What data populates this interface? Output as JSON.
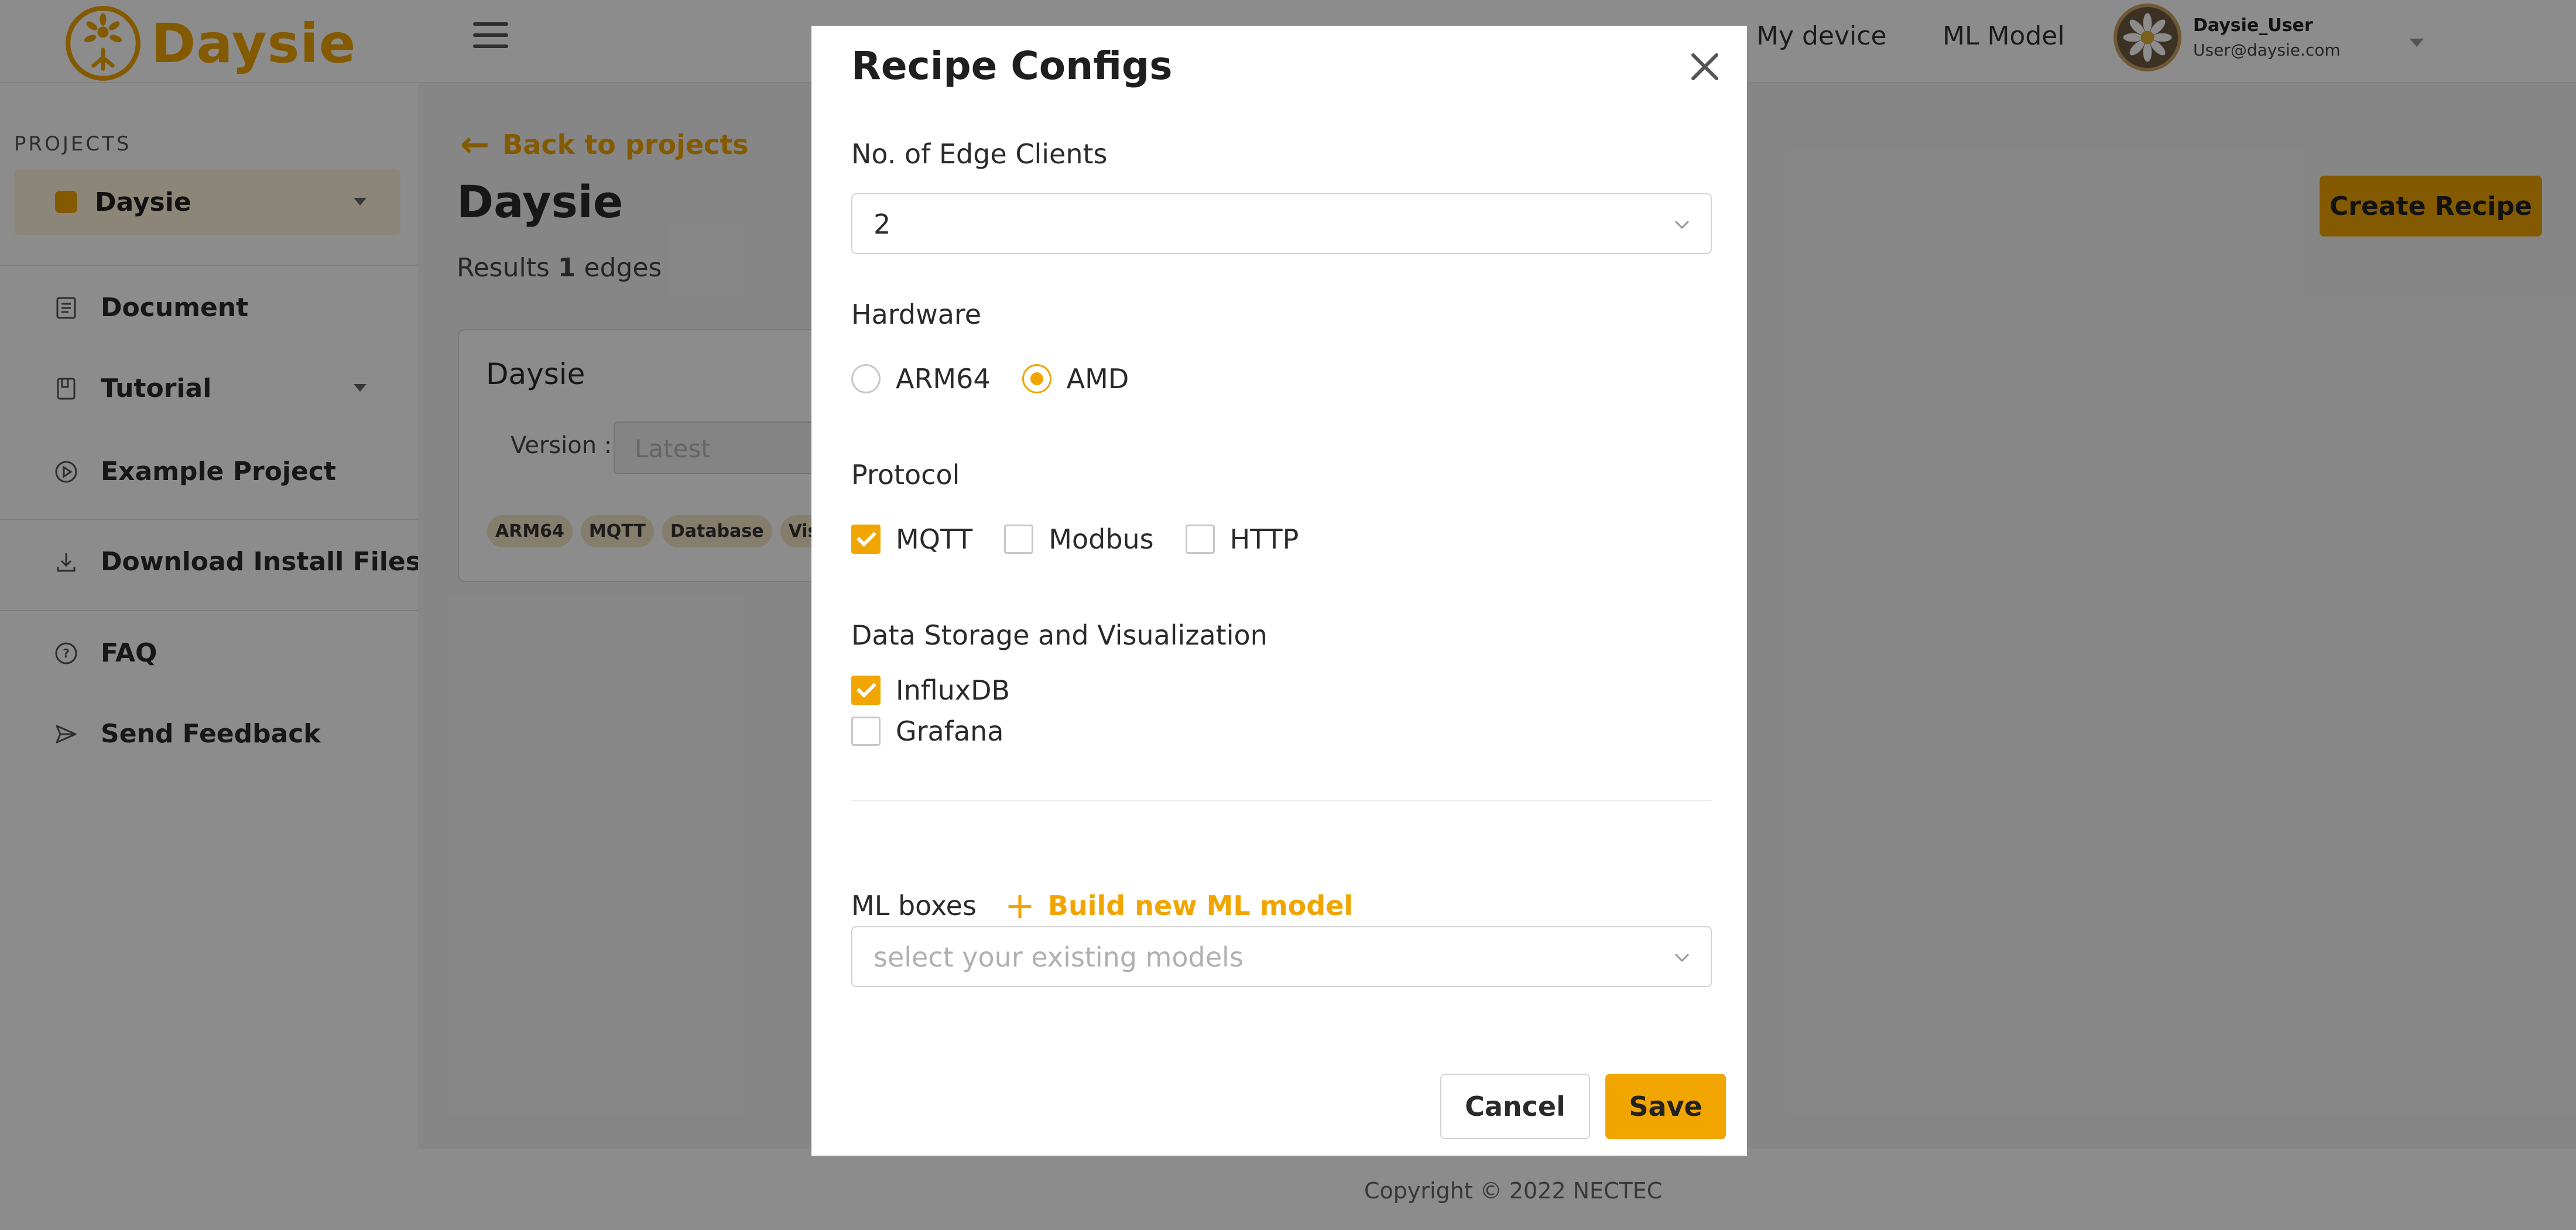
{
  "app": {
    "logo_text": "Daysie",
    "nav": {
      "my_device": "My device",
      "ml_model": "ML Model"
    },
    "user": {
      "name": "Daysie_User",
      "email": "User@daysie.com"
    }
  },
  "sidebar": {
    "projects_heading": "PROJECTS",
    "selected_project": "Daysie",
    "items": [
      {
        "label": "Document",
        "icon": "document-icon"
      },
      {
        "label": "Tutorial",
        "icon": "book-icon"
      },
      {
        "label": "Example Project",
        "icon": "play-circle-icon"
      },
      {
        "label": "Download Install Files",
        "icon": "download-icon"
      },
      {
        "label": "FAQ",
        "icon": "help-circle-icon"
      },
      {
        "label": "Send Feedback",
        "icon": "send-icon"
      }
    ]
  },
  "main": {
    "back_label": "Back to projects",
    "title": "Daysie",
    "results_prefix": "Results",
    "results_count": "1",
    "results_suffix": "edges",
    "create_button": "Create Recipe",
    "card": {
      "title": "Daysie",
      "version_label": "Version :",
      "version_value": "Latest",
      "tags": [
        "ARM64",
        "MQTT",
        "Database",
        "Visua"
      ]
    }
  },
  "footer": {
    "copyright": "Copyright © 2022 NECTEC"
  },
  "modal": {
    "title": "Recipe Configs",
    "edge_clients": {
      "label": "No. of Edge Clients",
      "value": "2"
    },
    "hardware": {
      "label": "Hardware",
      "options": [
        {
          "label": "ARM64",
          "selected": false
        },
        {
          "label": "AMD",
          "selected": true
        }
      ]
    },
    "protocol": {
      "label": "Protocol",
      "options": [
        {
          "label": "MQTT",
          "checked": true
        },
        {
          "label": "Modbus",
          "checked": false
        },
        {
          "label": "HTTP",
          "checked": false
        }
      ]
    },
    "storage": {
      "label": "Data Storage and Visualization",
      "options": [
        {
          "label": "InfluxDB",
          "checked": true
        },
        {
          "label": "Grafana",
          "checked": false
        }
      ]
    },
    "ml": {
      "label": "ML boxes",
      "build_label": "Build new ML model",
      "placeholder": "select your existing models"
    },
    "cancel_label": "Cancel",
    "save_label": "Save"
  },
  "colors": {
    "accent": "#f0a500",
    "overlay": "rgba(0,0,0,0.45)"
  }
}
